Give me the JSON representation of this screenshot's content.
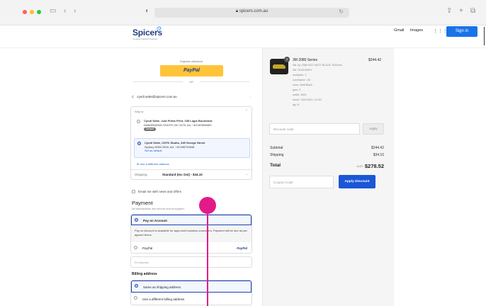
{
  "browser": {
    "url": "spicers.com.au",
    "colors": {
      "close": "#ff5f57",
      "minimize": "#febc2e",
      "maximize": "#28c840"
    }
  },
  "header": {
    "logo": "Spicers",
    "logo_tagline": "Creating Inspired Together",
    "links": [
      "Gmail",
      "Images"
    ],
    "signin_label": "Sign in"
  },
  "checkout": {
    "express_label": "Express checkout",
    "paypal_label": "PayPal",
    "or_label": "OR",
    "account_initial": "C",
    "account_email": "cyndi.sette@spicers.com.au",
    "ship_to_label": "Ship to",
    "addresses": [
      {
        "line1": "Cyndi Sette, Just Prints Print, 155 Logis Boulevard",
        "line2": "DANDENONG SOUTH VIC 3175, AU, +61397869400",
        "tag": "Default",
        "selected": false
      },
      {
        "line1": "Cyndi Sette, CNTK Studio, 345 George Street",
        "line2": "Sydney NSW 2000, AU, +61396793348",
        "link": "Set as default",
        "selected": true
      }
    ],
    "different_address": "Use a different address",
    "shipping_label": "Shipping",
    "shipping_value": "Standard (Inc Gst) - $34.10",
    "email_optin": "Email me with news and offers",
    "payment_heading": "Payment",
    "payment_sub": "All transactions are secure and encrypted.",
    "pay_on_account": "Pay on Account",
    "pay_on_account_desc": "Pay on Account is available for approved business customers. Payment will be due as per agreed terms.",
    "paypal_option": "PayPal",
    "po_placeholder": "Po Number",
    "billing_heading": "Billing address",
    "billing_same": "Same as shipping address",
    "billing_diff": "Use a different billing address"
  },
  "summary": {
    "product": {
      "qty_badge": "1",
      "name": "3M 2080 Series",
      "price": "$244.42",
      "details": [
        "3M 1yr 2080 M12 MATT BLACK 1520mm",
        "3M 7100193097",
        "multiplier: 1",
        "uomName: LM",
        "color: Matt Black",
        "gsm: 0",
        "width: 1524",
        "sheet: 1524.000 x 22.80",
        "qty: 8"
      ]
    },
    "discount_placeholder": "Discount code",
    "apply_label": "Apply",
    "subtotal_label": "Subtotal",
    "subtotal_value": "$244.42",
    "shipping_label": "Shipping",
    "shipping_value": "$34.10",
    "total_label": "Total",
    "total_currency": "AUD",
    "total_value": "$278.52",
    "coupon_placeholder": "Coupon Code",
    "apply_discount_label": "Apply Discount"
  }
}
